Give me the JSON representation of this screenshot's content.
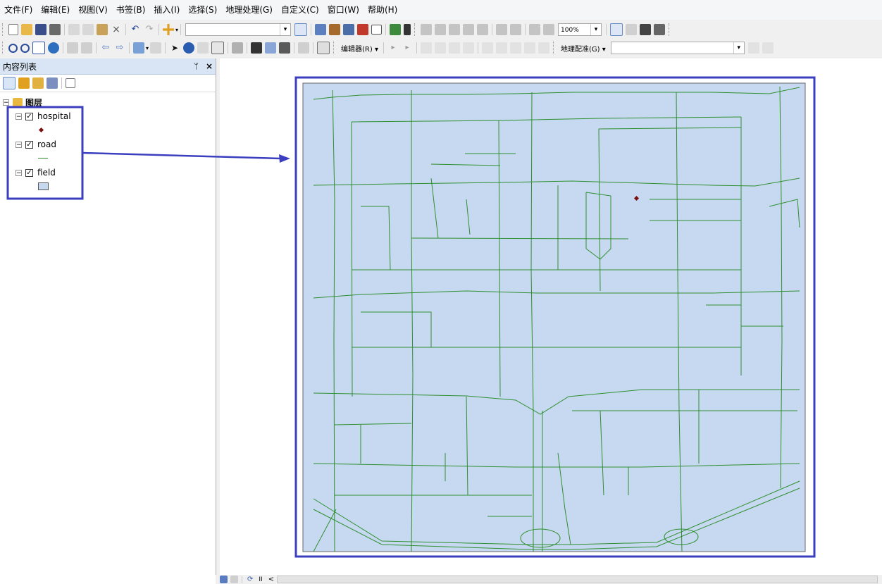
{
  "menu": [
    "文件(F)",
    "编辑(E)",
    "视图(V)",
    "书签(B)",
    "插入(I)",
    "选择(S)",
    "地理处理(G)",
    "自定义(C)",
    "窗口(W)",
    "帮助(H)"
  ],
  "toolbar": {
    "scale_value": "",
    "zoom_value": "100%",
    "editor_label": "编辑器(R) ▾",
    "georef_label": "地理配准(G) ▾",
    "georef_layer": ""
  },
  "toc": {
    "title": "内容列表",
    "pin": "ᛘ",
    "close": "×",
    "root_label": "图层",
    "layers": [
      {
        "name": "hospital",
        "checked": true,
        "symbol": "point",
        "color": "#7a1010"
      },
      {
        "name": "road",
        "checked": true,
        "symbol": "line",
        "color": "#2a8a2a"
      },
      {
        "name": "field",
        "checked": true,
        "symbol": "polygon",
        "color": "#c6d9f1"
      }
    ]
  },
  "colors": {
    "highlight": "#3b3fbf",
    "field_fill": "#c6d9f1",
    "road_stroke": "#2f8f2f",
    "hospital": "#7a1010"
  },
  "status": {
    "pause": "II",
    "scroll_left": "<"
  }
}
